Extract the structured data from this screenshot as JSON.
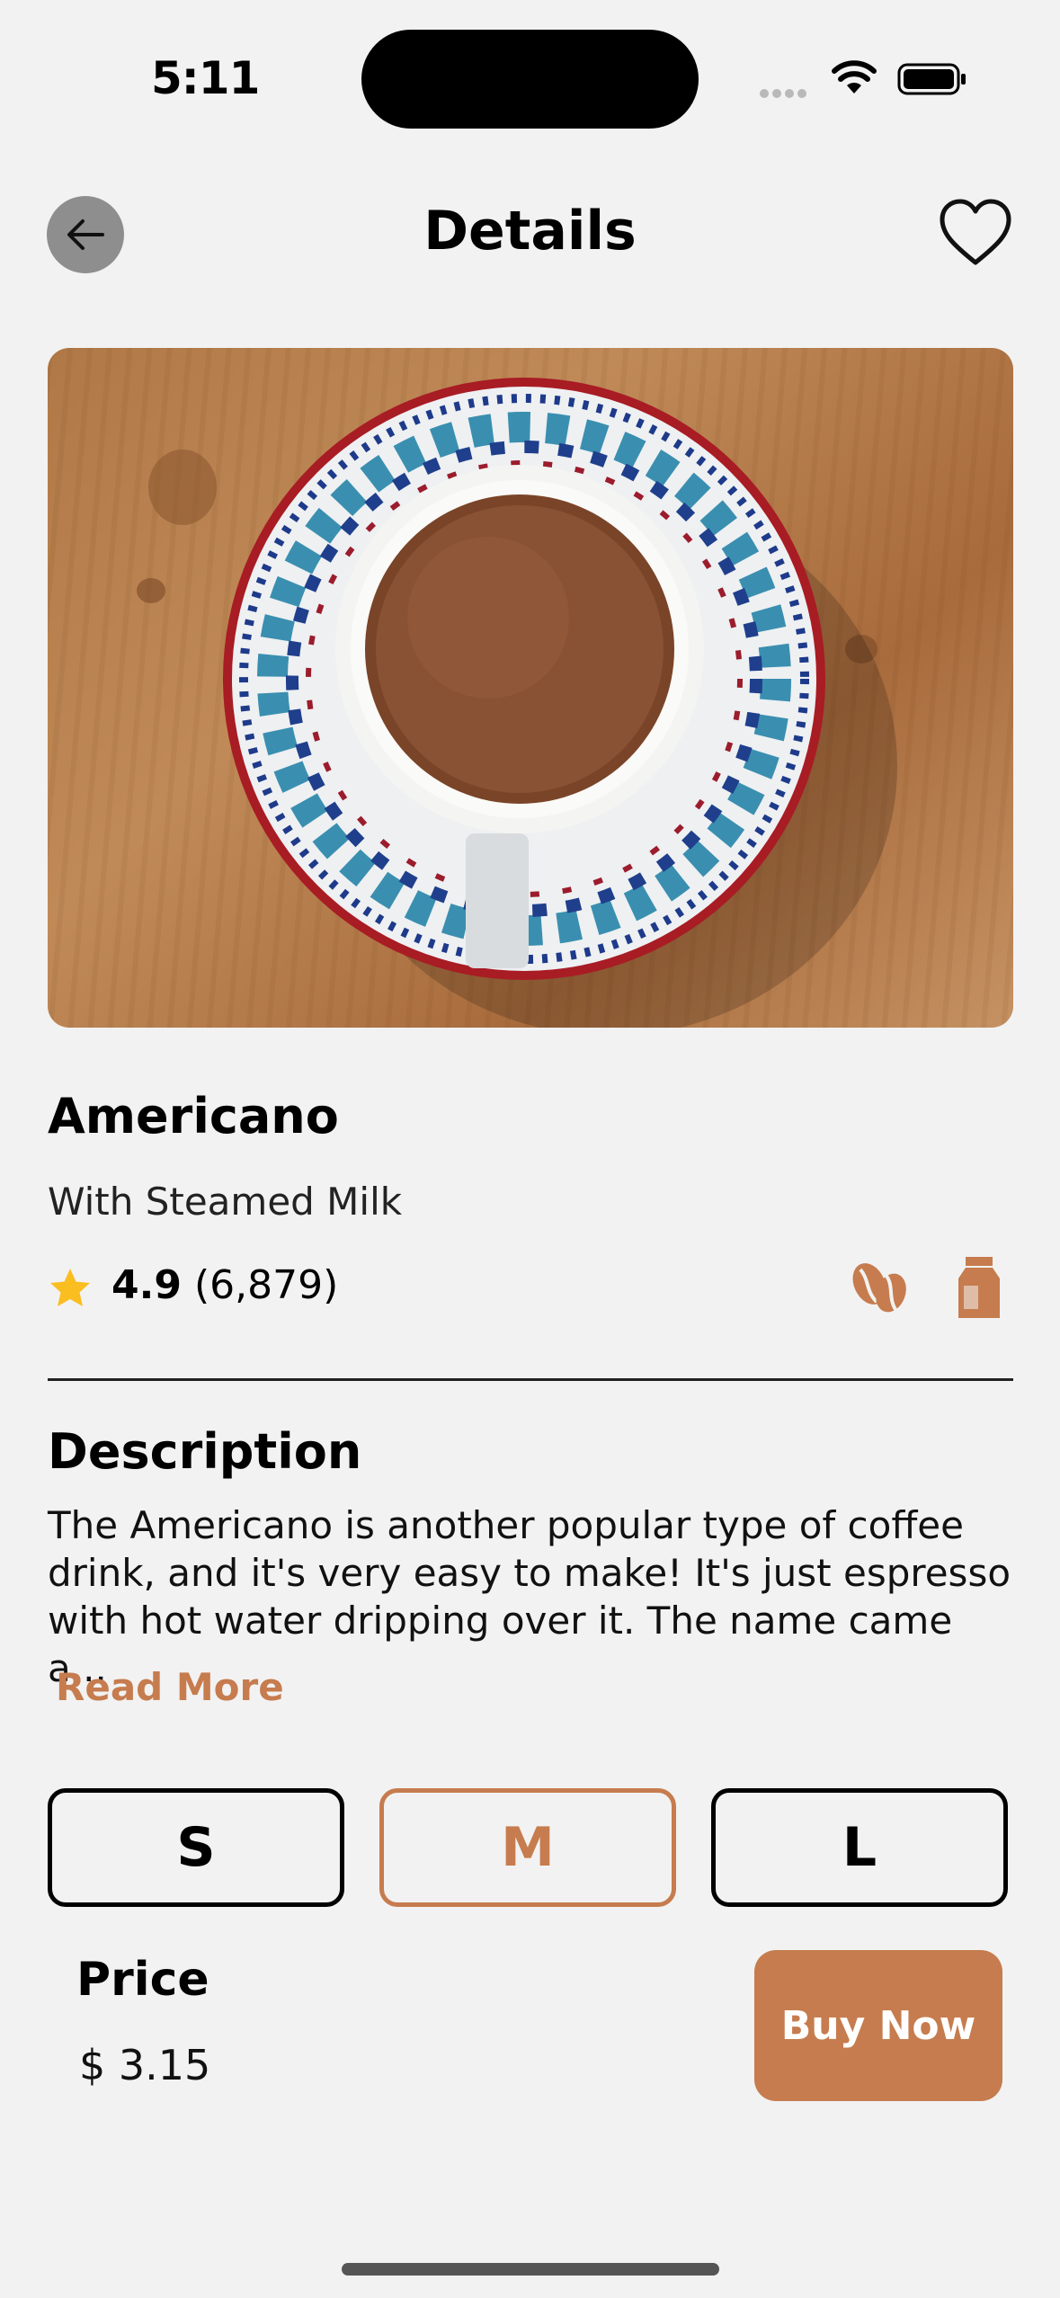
{
  "status_bar": {
    "time": "5:11"
  },
  "header": {
    "title": "Details"
  },
  "product": {
    "name": "Americano",
    "subtitle": "With Steamed Milk",
    "rating": "4.9",
    "rating_count": "(6,879)"
  },
  "description": {
    "heading": "Description",
    "text": "The Americano is another popular type of coffee drink, and it's very easy to make! It's just espresso with hot water dripping over it. The name came a...",
    "read_more": "Read More"
  },
  "sizes": {
    "options": [
      "S",
      "M",
      "L"
    ],
    "selected": "M"
  },
  "price": {
    "label": "Price",
    "value": "$ 3.15"
  },
  "buy_button": {
    "label": "Buy Now"
  },
  "colors": {
    "accent": "#c67c4e",
    "background": "#f2f2f2",
    "star": "#fbbe21"
  }
}
